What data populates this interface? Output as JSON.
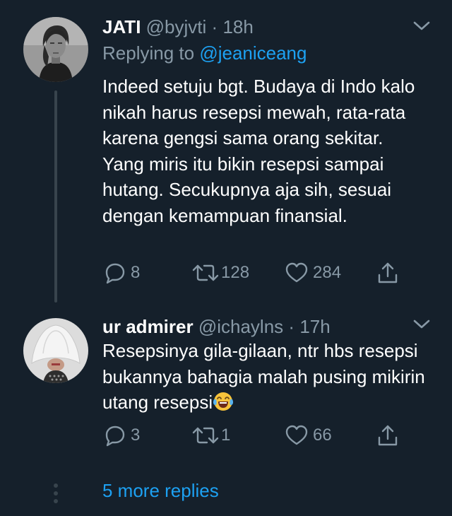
{
  "theme": {
    "background": "#15202b",
    "text": "#ffffff",
    "muted": "#8899a6",
    "accent": "#1da1f2",
    "thread_line": "#38444d"
  },
  "tweets": [
    {
      "name": "JATI",
      "handle": "@byjvti",
      "separator": "·",
      "time": "18h",
      "replying_prefix": "Replying to ",
      "replying_to": "@jeaniceang",
      "text": "Indeed setuju bgt. Budaya di Indo kalo nikah harus resepsi mewah, rata-rata karena gengsi sama orang sekitar. Yang miris itu bikin resepsi sampai hutang. Secukupnya aja sih, sesuai dengan kemampuan finansial.",
      "avatar_icon": "profile-photo-woman",
      "menu_icon": "chevron-down-icon",
      "replies": "8",
      "retweets": "128",
      "likes": "284"
    },
    {
      "name": "ur admirer",
      "handle": "@ichaylns",
      "separator": "·",
      "time": "17h",
      "text": "Resepsinya gila-gilaan, ntr hbs resepsi bukannya bahagia malah pusing mikirin utang resepsi",
      "trailing_emoji": "face-with-tears-of-joy",
      "avatar_icon": "profile-photo-hat",
      "menu_icon": "chevron-down-icon",
      "replies": "3",
      "retweets": "1",
      "likes": "66"
    }
  ],
  "more_replies_label": "5 more replies"
}
